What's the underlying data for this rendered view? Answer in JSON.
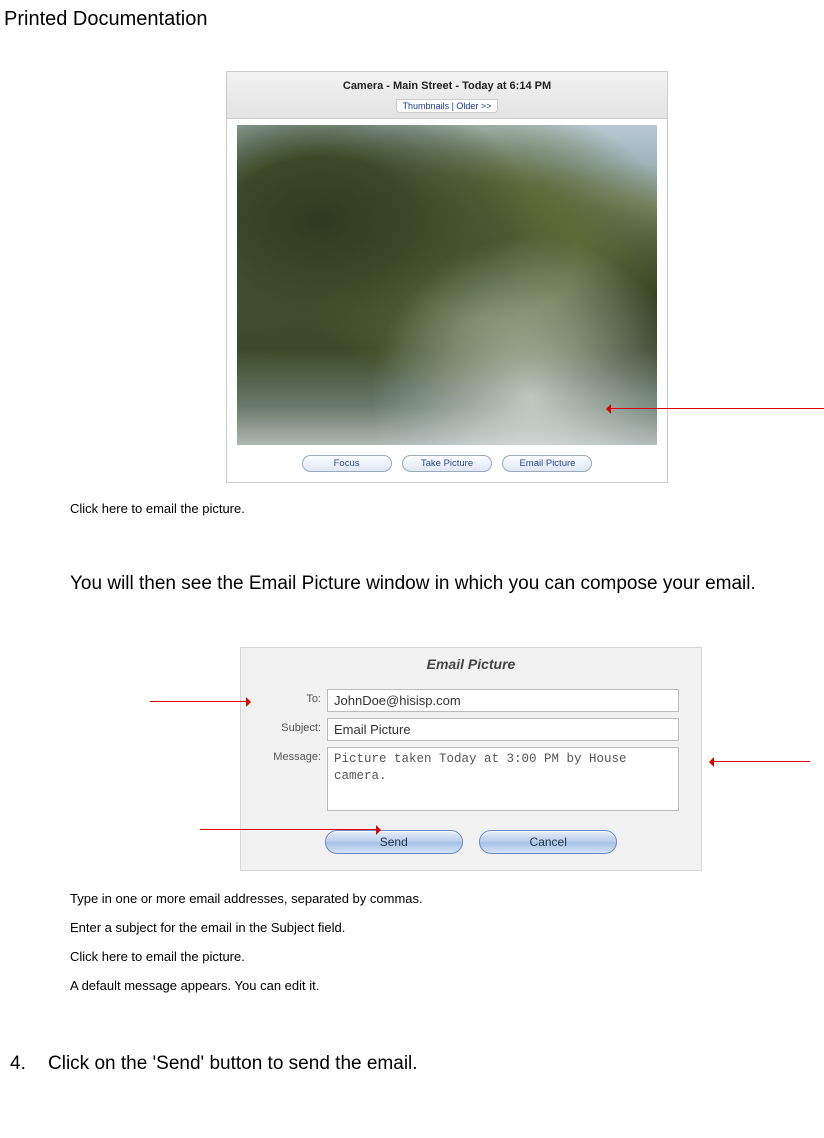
{
  "header": {
    "title": "Printed Documentation"
  },
  "camera": {
    "title": "Camera - Main Street - Today at 6:14 PM",
    "nav": "Thumbnails | Older >>",
    "buttons": {
      "focus": "Focus",
      "take": "Take Picture",
      "email": "Email Picture"
    }
  },
  "caption1": "Click here to email the picture.",
  "body1": "You will then see the Email Picture window in which you can compose your email.",
  "email": {
    "title": "Email Picture",
    "labels": {
      "to": "To:",
      "subject": "Subject:",
      "message": "Message:"
    },
    "fields": {
      "to": "JohnDoe@hisisp.com",
      "subject": "Email Picture",
      "message": "Picture taken Today at 3:00 PM by House camera."
    },
    "buttons": {
      "send": "Send",
      "cancel": "Cancel"
    }
  },
  "notes": {
    "n1": "Type in one or more email addresses, separated by commas.",
    "n2": "Enter a subject for the email in the Subject field.",
    "n3": "Click here to email the picture.",
    "n4": "A default message appears. You can edit it."
  },
  "step4": {
    "num": "4.",
    "text": "Click on the 'Send' button to send the email."
  }
}
